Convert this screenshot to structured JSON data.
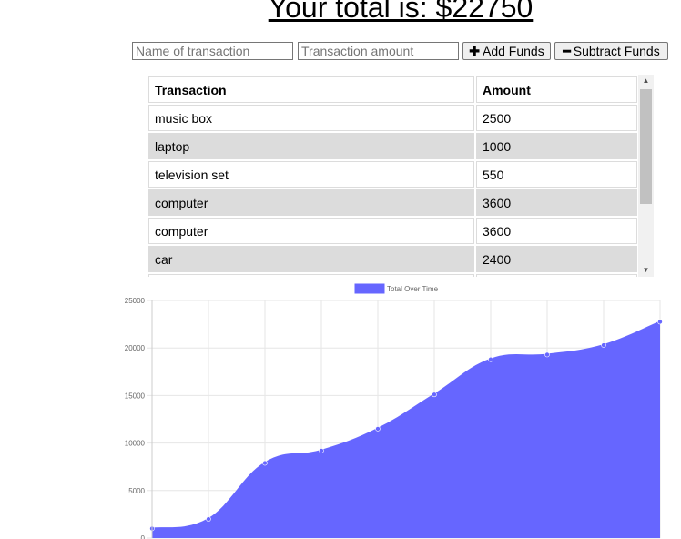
{
  "header": {
    "total_text": "Your total is: $22750"
  },
  "controls": {
    "name_placeholder": "Name of transaction",
    "amount_placeholder": "Transaction amount",
    "add_label": "Add Funds",
    "add_icon": "plus-icon",
    "subtract_label": "Subtract Funds",
    "subtract_icon": "minus-icon"
  },
  "table": {
    "headers": [
      "Transaction",
      "Amount"
    ],
    "rows": [
      {
        "name": "music box",
        "amount": "2500"
      },
      {
        "name": "laptop",
        "amount": "1000"
      },
      {
        "name": "television set",
        "amount": "550"
      },
      {
        "name": "computer",
        "amount": "3600"
      },
      {
        "name": "computer",
        "amount": "3600"
      },
      {
        "name": "car",
        "amount": "2400"
      }
    ]
  },
  "chart_data": {
    "type": "area",
    "series": [
      {
        "name": "Total Over Time",
        "color": "#6666ff",
        "values": [
          1000,
          2000,
          7900,
          9200,
          11500,
          15100,
          18800,
          19300,
          20300,
          22750
        ]
      }
    ],
    "ylim": [
      0,
      25000
    ],
    "yticks": [
      "0",
      "5000",
      "10000",
      "15000",
      "20000",
      "25000"
    ],
    "grid": true,
    "legend": "top"
  }
}
